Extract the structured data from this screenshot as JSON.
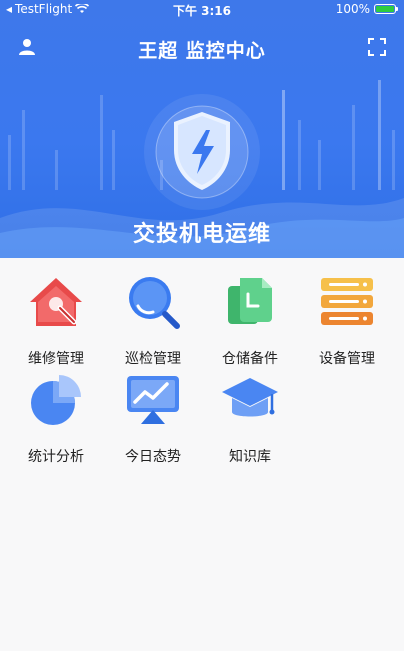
{
  "status_bar": {
    "carrier": "TestFlight",
    "time": "下午 3:16",
    "battery": "100%"
  },
  "header": {
    "title": "王超 监控中心",
    "subtitle": "交投机电运维"
  },
  "menu": [
    {
      "label": "维修管理",
      "icon": "repair-house-icon"
    },
    {
      "label": "巡检管理",
      "icon": "magnifier-icon"
    },
    {
      "label": "仓储备件",
      "icon": "document-copy-icon"
    },
    {
      "label": "设备管理",
      "icon": "server-stack-icon"
    },
    {
      "label": "统计分析",
      "icon": "pie-chart-icon"
    },
    {
      "label": "今日态势",
      "icon": "trend-screen-icon"
    },
    {
      "label": "知识库",
      "icon": "graduation-cap-icon"
    }
  ],
  "colors": {
    "header_blue": "#3b78ef",
    "red": "#e84a4a",
    "blue": "#3a7bf0",
    "green": "#44c27a",
    "orange": "#f0a53a"
  }
}
